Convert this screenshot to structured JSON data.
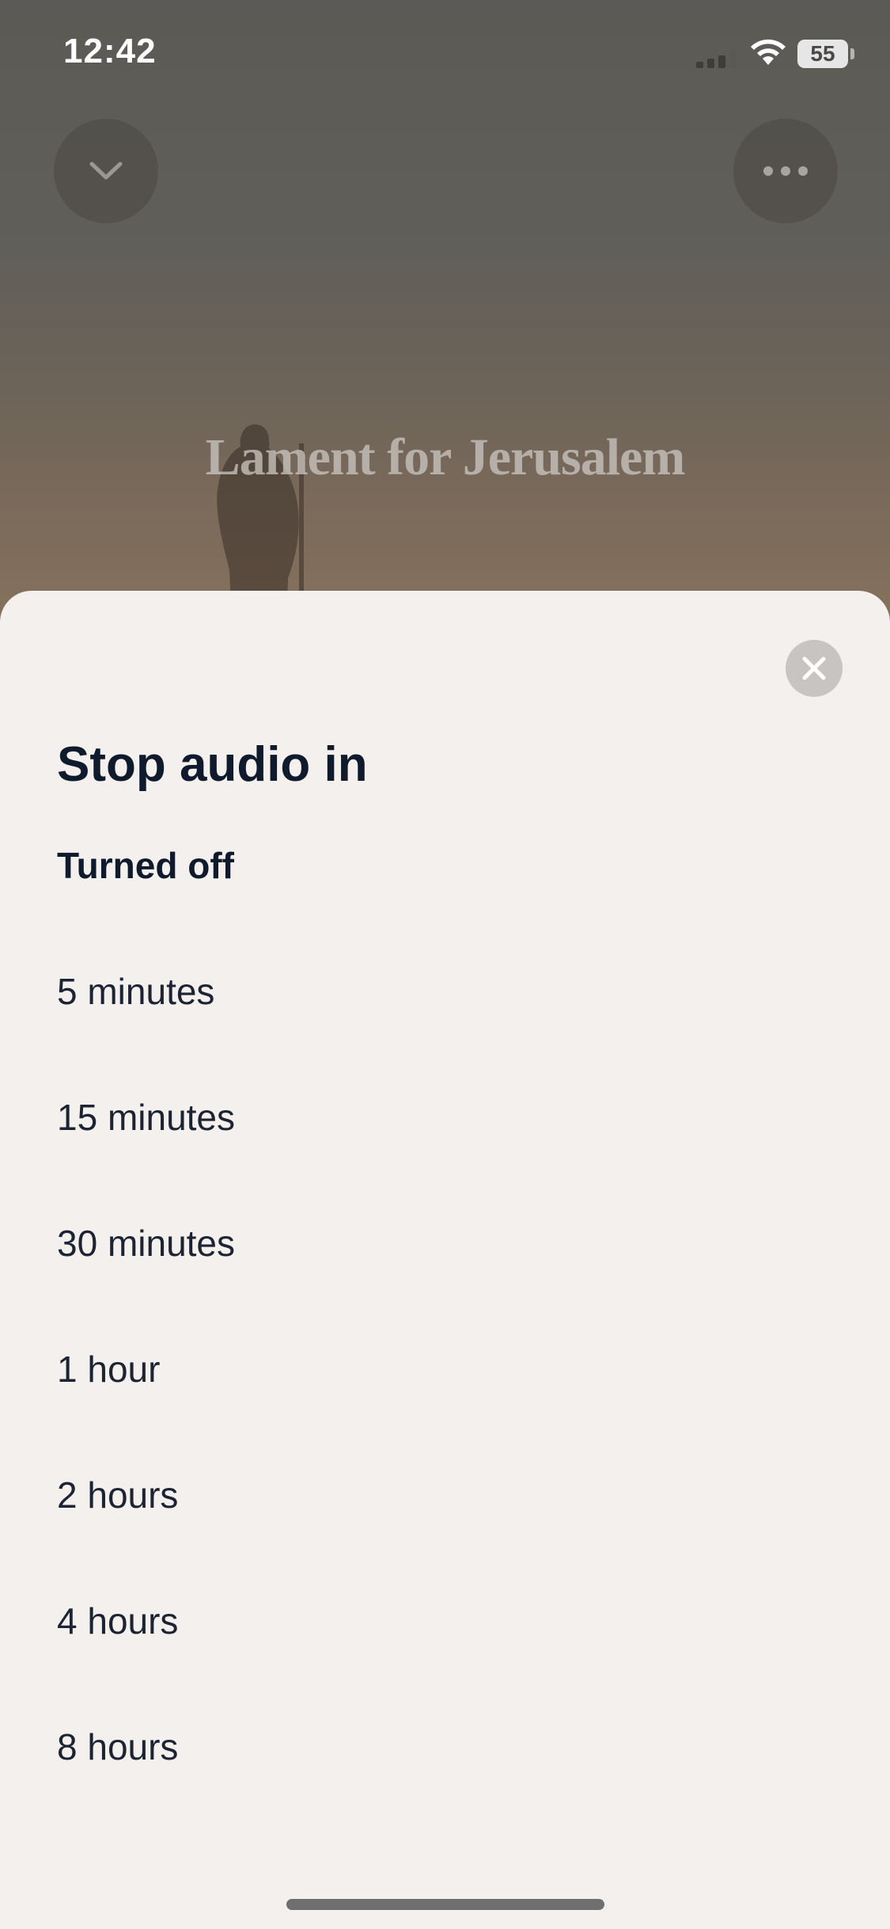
{
  "status_bar": {
    "time": "12:42",
    "battery_level": "55",
    "icons": [
      "cellular-signal-icon",
      "wifi-icon",
      "battery-icon"
    ]
  },
  "player": {
    "episode_title": "Lament for Jerusalem",
    "icons": [
      "chevron-down-icon",
      "more-horizontal-icon"
    ]
  },
  "sheet": {
    "title": "Stop audio in",
    "close_icon": "close-icon",
    "options": [
      {
        "label": "Turned off",
        "selected": true
      },
      {
        "label": "5 minutes",
        "selected": false
      },
      {
        "label": "15 minutes",
        "selected": false
      },
      {
        "label": "30 minutes",
        "selected": false
      },
      {
        "label": "1 hour",
        "selected": false
      },
      {
        "label": "2 hours",
        "selected": false
      },
      {
        "label": "4 hours",
        "selected": false
      },
      {
        "label": "8 hours",
        "selected": false
      }
    ]
  },
  "colors": {
    "sheet_background": "#f4f0ee",
    "title_text": "#0f1b2d",
    "option_text": "#1c2433",
    "close_button": "#c8c4c1"
  }
}
